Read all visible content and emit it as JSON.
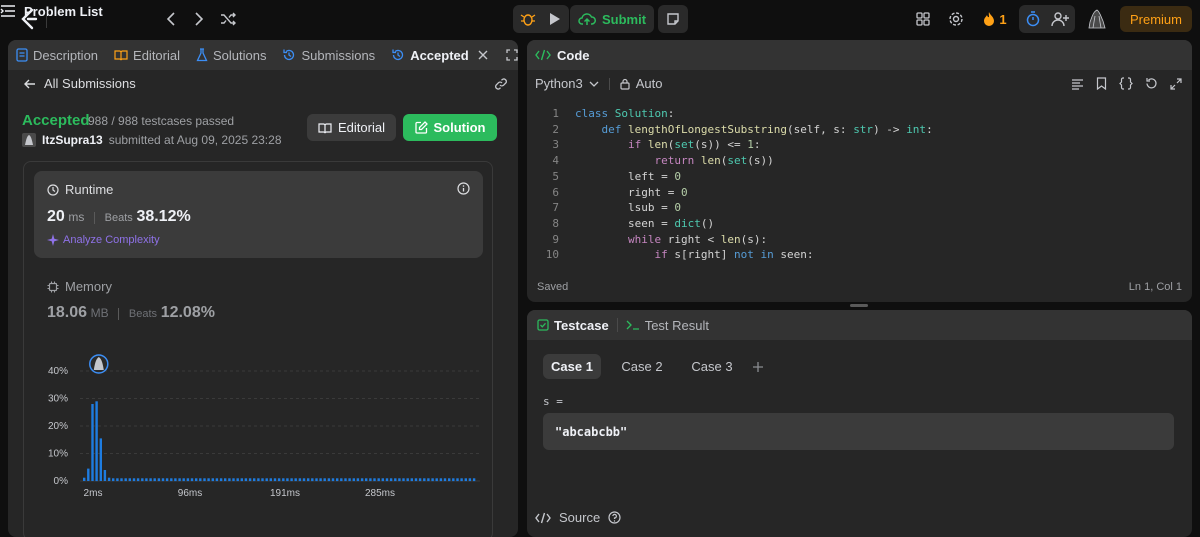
{
  "topbar": {
    "problem_list_label": "Problem List",
    "submit_label": "Submit",
    "streak_count": "1",
    "premium_label": "Premium"
  },
  "left_tabs": [
    "Description",
    "Editorial",
    "Solutions",
    "Submissions",
    "Accepted"
  ],
  "submission": {
    "back_label": "All Submissions",
    "status": "Accepted",
    "testcases": "988 / 988 testcases passed",
    "user": "ItzSupra13",
    "submitted_at": "submitted at Aug 09, 2025 23:28",
    "editorial_label": "Editorial",
    "solution_label": "Solution"
  },
  "runtime": {
    "label": "Runtime",
    "value": "20",
    "unit": "ms",
    "beats_label": "Beats",
    "beats_value": "38.12%",
    "analyze_label": "Analyze Complexity"
  },
  "memory": {
    "label": "Memory",
    "value": "18.06",
    "unit": "MB",
    "beats_label": "Beats",
    "beats_value": "12.08%"
  },
  "chart_data": {
    "type": "bar",
    "y_ticks": [
      "40%",
      "30%",
      "20%",
      "10%",
      "0%"
    ],
    "x_ticks": [
      "2ms",
      "96ms",
      "191ms",
      "285ms"
    ],
    "ylim": [
      0,
      40
    ],
    "values": [
      1.2,
      4.5,
      28,
      29,
      15.5,
      4,
      1.2,
      1,
      1,
      1,
      1,
      1,
      1,
      1,
      1,
      1,
      1,
      1,
      1,
      1,
      1,
      1,
      1,
      1,
      1,
      1,
      1,
      1,
      1,
      1,
      1,
      1,
      1,
      1,
      1,
      1,
      1,
      1,
      1,
      1,
      1,
      1,
      1,
      1,
      1,
      1,
      1,
      1,
      1,
      1,
      1,
      1,
      1,
      1,
      1,
      1,
      1,
      1,
      1,
      1,
      1,
      1,
      1,
      1,
      1,
      1,
      1,
      1,
      1,
      1,
      1,
      1,
      1,
      1,
      1,
      1,
      1,
      1,
      1,
      1,
      1,
      1,
      1,
      1,
      1,
      1,
      1,
      1,
      1,
      1,
      1,
      1,
      1,
      1,
      1
    ],
    "highlight_index": 4,
    "bar_color": "#1e7ce0"
  },
  "code_panel": {
    "title": "Code",
    "language": "Python3",
    "mode": "Auto",
    "saved_label": "Saved",
    "cursor": "Ln 1, Col 1",
    "lines": [
      {
        "n": "1",
        "indent": 0,
        "parts": [
          [
            "kw",
            "class"
          ],
          [
            "p",
            " "
          ],
          [
            "cls",
            "Solution"
          ],
          [
            "p",
            ":"
          ]
        ]
      },
      {
        "n": "2",
        "indent": 1,
        "parts": [
          [
            "kw",
            "def"
          ],
          [
            "p",
            " "
          ],
          [
            "fn",
            "lengthOfLongestSubstring"
          ],
          [
            "p",
            "(self, s: "
          ],
          [
            "cls",
            "str"
          ],
          [
            "p",
            ") -> "
          ],
          [
            "cls",
            "int"
          ],
          [
            "p",
            ":"
          ]
        ]
      },
      {
        "n": "3",
        "indent": 2,
        "parts": [
          [
            "kw2",
            "if"
          ],
          [
            "p",
            " "
          ],
          [
            "fn",
            "len"
          ],
          [
            "p",
            "("
          ],
          [
            "cls",
            "set"
          ],
          [
            "p",
            "(s)) <= "
          ],
          [
            "num",
            "1"
          ],
          [
            "p",
            ":"
          ]
        ]
      },
      {
        "n": "4",
        "indent": 3,
        "parts": [
          [
            "kw2",
            "return"
          ],
          [
            "p",
            " "
          ],
          [
            "fn",
            "len"
          ],
          [
            "p",
            "("
          ],
          [
            "cls",
            "set"
          ],
          [
            "p",
            "(s))"
          ]
        ]
      },
      {
        "n": "5",
        "indent": 2,
        "parts": [
          [
            "p",
            "left = "
          ],
          [
            "num",
            "0"
          ]
        ]
      },
      {
        "n": "6",
        "indent": 2,
        "parts": [
          [
            "p",
            "right = "
          ],
          [
            "num",
            "0"
          ]
        ]
      },
      {
        "n": "7",
        "indent": 2,
        "parts": [
          [
            "p",
            "lsub = "
          ],
          [
            "num",
            "0"
          ]
        ]
      },
      {
        "n": "8",
        "indent": 2,
        "parts": [
          [
            "p",
            "seen = "
          ],
          [
            "cls",
            "dict"
          ],
          [
            "p",
            "()"
          ]
        ]
      },
      {
        "n": "9",
        "indent": 2,
        "parts": [
          [
            "kw2",
            "while"
          ],
          [
            "p",
            " right < "
          ],
          [
            "fn",
            "len"
          ],
          [
            "p",
            "(s):"
          ]
        ]
      },
      {
        "n": "10",
        "indent": 3,
        "parts": [
          [
            "kw2",
            "if"
          ],
          [
            "p",
            " s[right] "
          ],
          [
            "kw",
            "not in"
          ],
          [
            "p",
            " seen:"
          ]
        ]
      }
    ]
  },
  "test_panel": {
    "testcase_label": "Testcase",
    "result_label": "Test Result",
    "cases": [
      "Case 1",
      "Case 2",
      "Case 3"
    ],
    "var_label": "s =",
    "var_value": "\"abcabcbb\"",
    "source_label": "Source"
  }
}
